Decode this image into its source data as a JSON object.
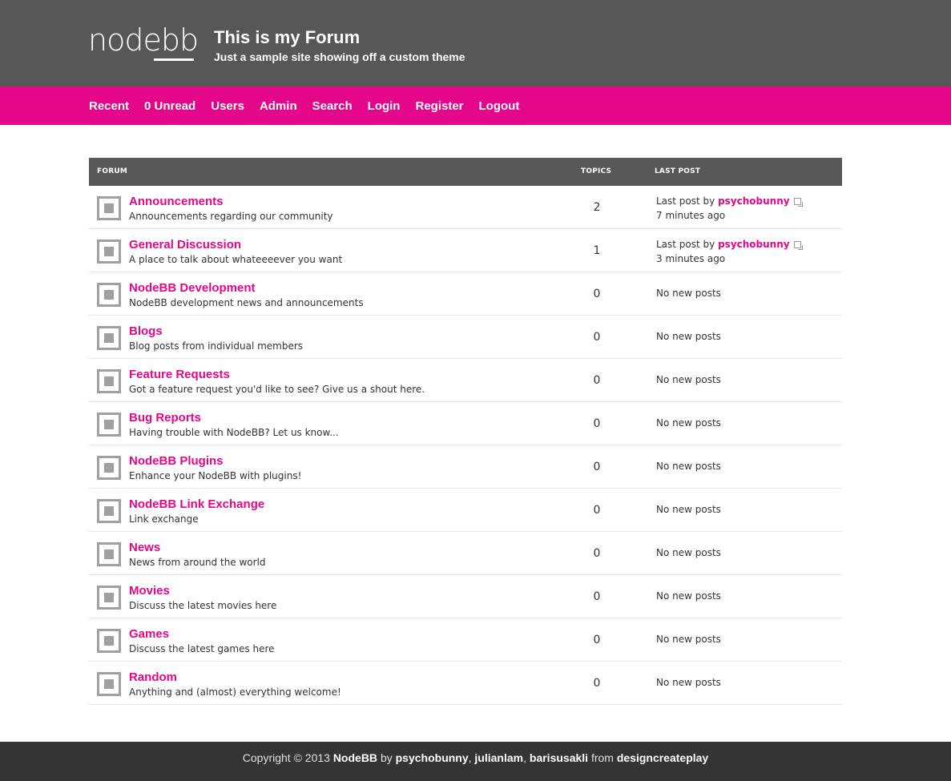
{
  "header": {
    "logo_text": "nodebb",
    "title": "This is my Forum",
    "subtitle": "Just a sample site showing off a custom theme"
  },
  "nav": [
    {
      "label": "Recent"
    },
    {
      "label": "0 Unread"
    },
    {
      "label": "Users"
    },
    {
      "label": "Admin"
    },
    {
      "label": "Search"
    },
    {
      "label": "Login"
    },
    {
      "label": "Register"
    },
    {
      "label": "Logout"
    }
  ],
  "table": {
    "headers": {
      "forum": "FORUM",
      "topics": "TOPICS",
      "last_post": "LAST POST"
    },
    "categories": [
      {
        "name": "Announcements",
        "description": "Announcements regarding our community",
        "topics": "2",
        "last_prefix": "Last post by",
        "last_user": "psychobunny",
        "last_time": "7 minutes ago"
      },
      {
        "name": "General Discussion",
        "description": "A place to talk about whateeeever you want",
        "topics": "1",
        "last_prefix": "Last post by",
        "last_user": "psychobunny",
        "last_time": "3 minutes ago"
      },
      {
        "name": "NodeBB Development",
        "description": "NodeBB development news and announcements",
        "topics": "0",
        "last_text": "No new posts"
      },
      {
        "name": "Blogs",
        "description": "Blog posts from individual members",
        "topics": "0",
        "last_text": "No new posts"
      },
      {
        "name": "Feature Requests",
        "description": "Got a feature request you'd like to see? Give us a shout here.",
        "topics": "0",
        "last_text": "No new posts"
      },
      {
        "name": "Bug Reports",
        "description": "Having trouble with NodeBB? Let us know...",
        "topics": "0",
        "last_text": "No new posts"
      },
      {
        "name": "NodeBB Plugins",
        "description": "Enhance your NodeBB with plugins!",
        "topics": "0",
        "last_text": "No new posts"
      },
      {
        "name": "NodeBB Link Exchange",
        "description": "Link exchange",
        "topics": "0",
        "last_text": "No new posts"
      },
      {
        "name": "News",
        "description": "News from around the world",
        "topics": "0",
        "last_text": "No new posts"
      },
      {
        "name": "Movies",
        "description": "Discuss the latest movies here",
        "topics": "0",
        "last_text": "No new posts"
      },
      {
        "name": "Games",
        "description": "Discuss the latest games here",
        "topics": "0",
        "last_text": "No new posts"
      },
      {
        "name": "Random",
        "description": "Anything and (almost) everything welcome!",
        "topics": "0",
        "last_text": "No new posts"
      }
    ]
  },
  "footer": {
    "copyright": "Copyright © 2013",
    "brand": "NodeBB",
    "by": "by",
    "author1": "psychobunny",
    "comma1": ",",
    "author2": "julianlam",
    "comma2": ",",
    "author3": "barisusakli",
    "from": "from",
    "company": "designcreateplay"
  },
  "colors": {
    "header_bg": "#575757",
    "accent": "#e5078a",
    "footer_bg": "#343434"
  }
}
